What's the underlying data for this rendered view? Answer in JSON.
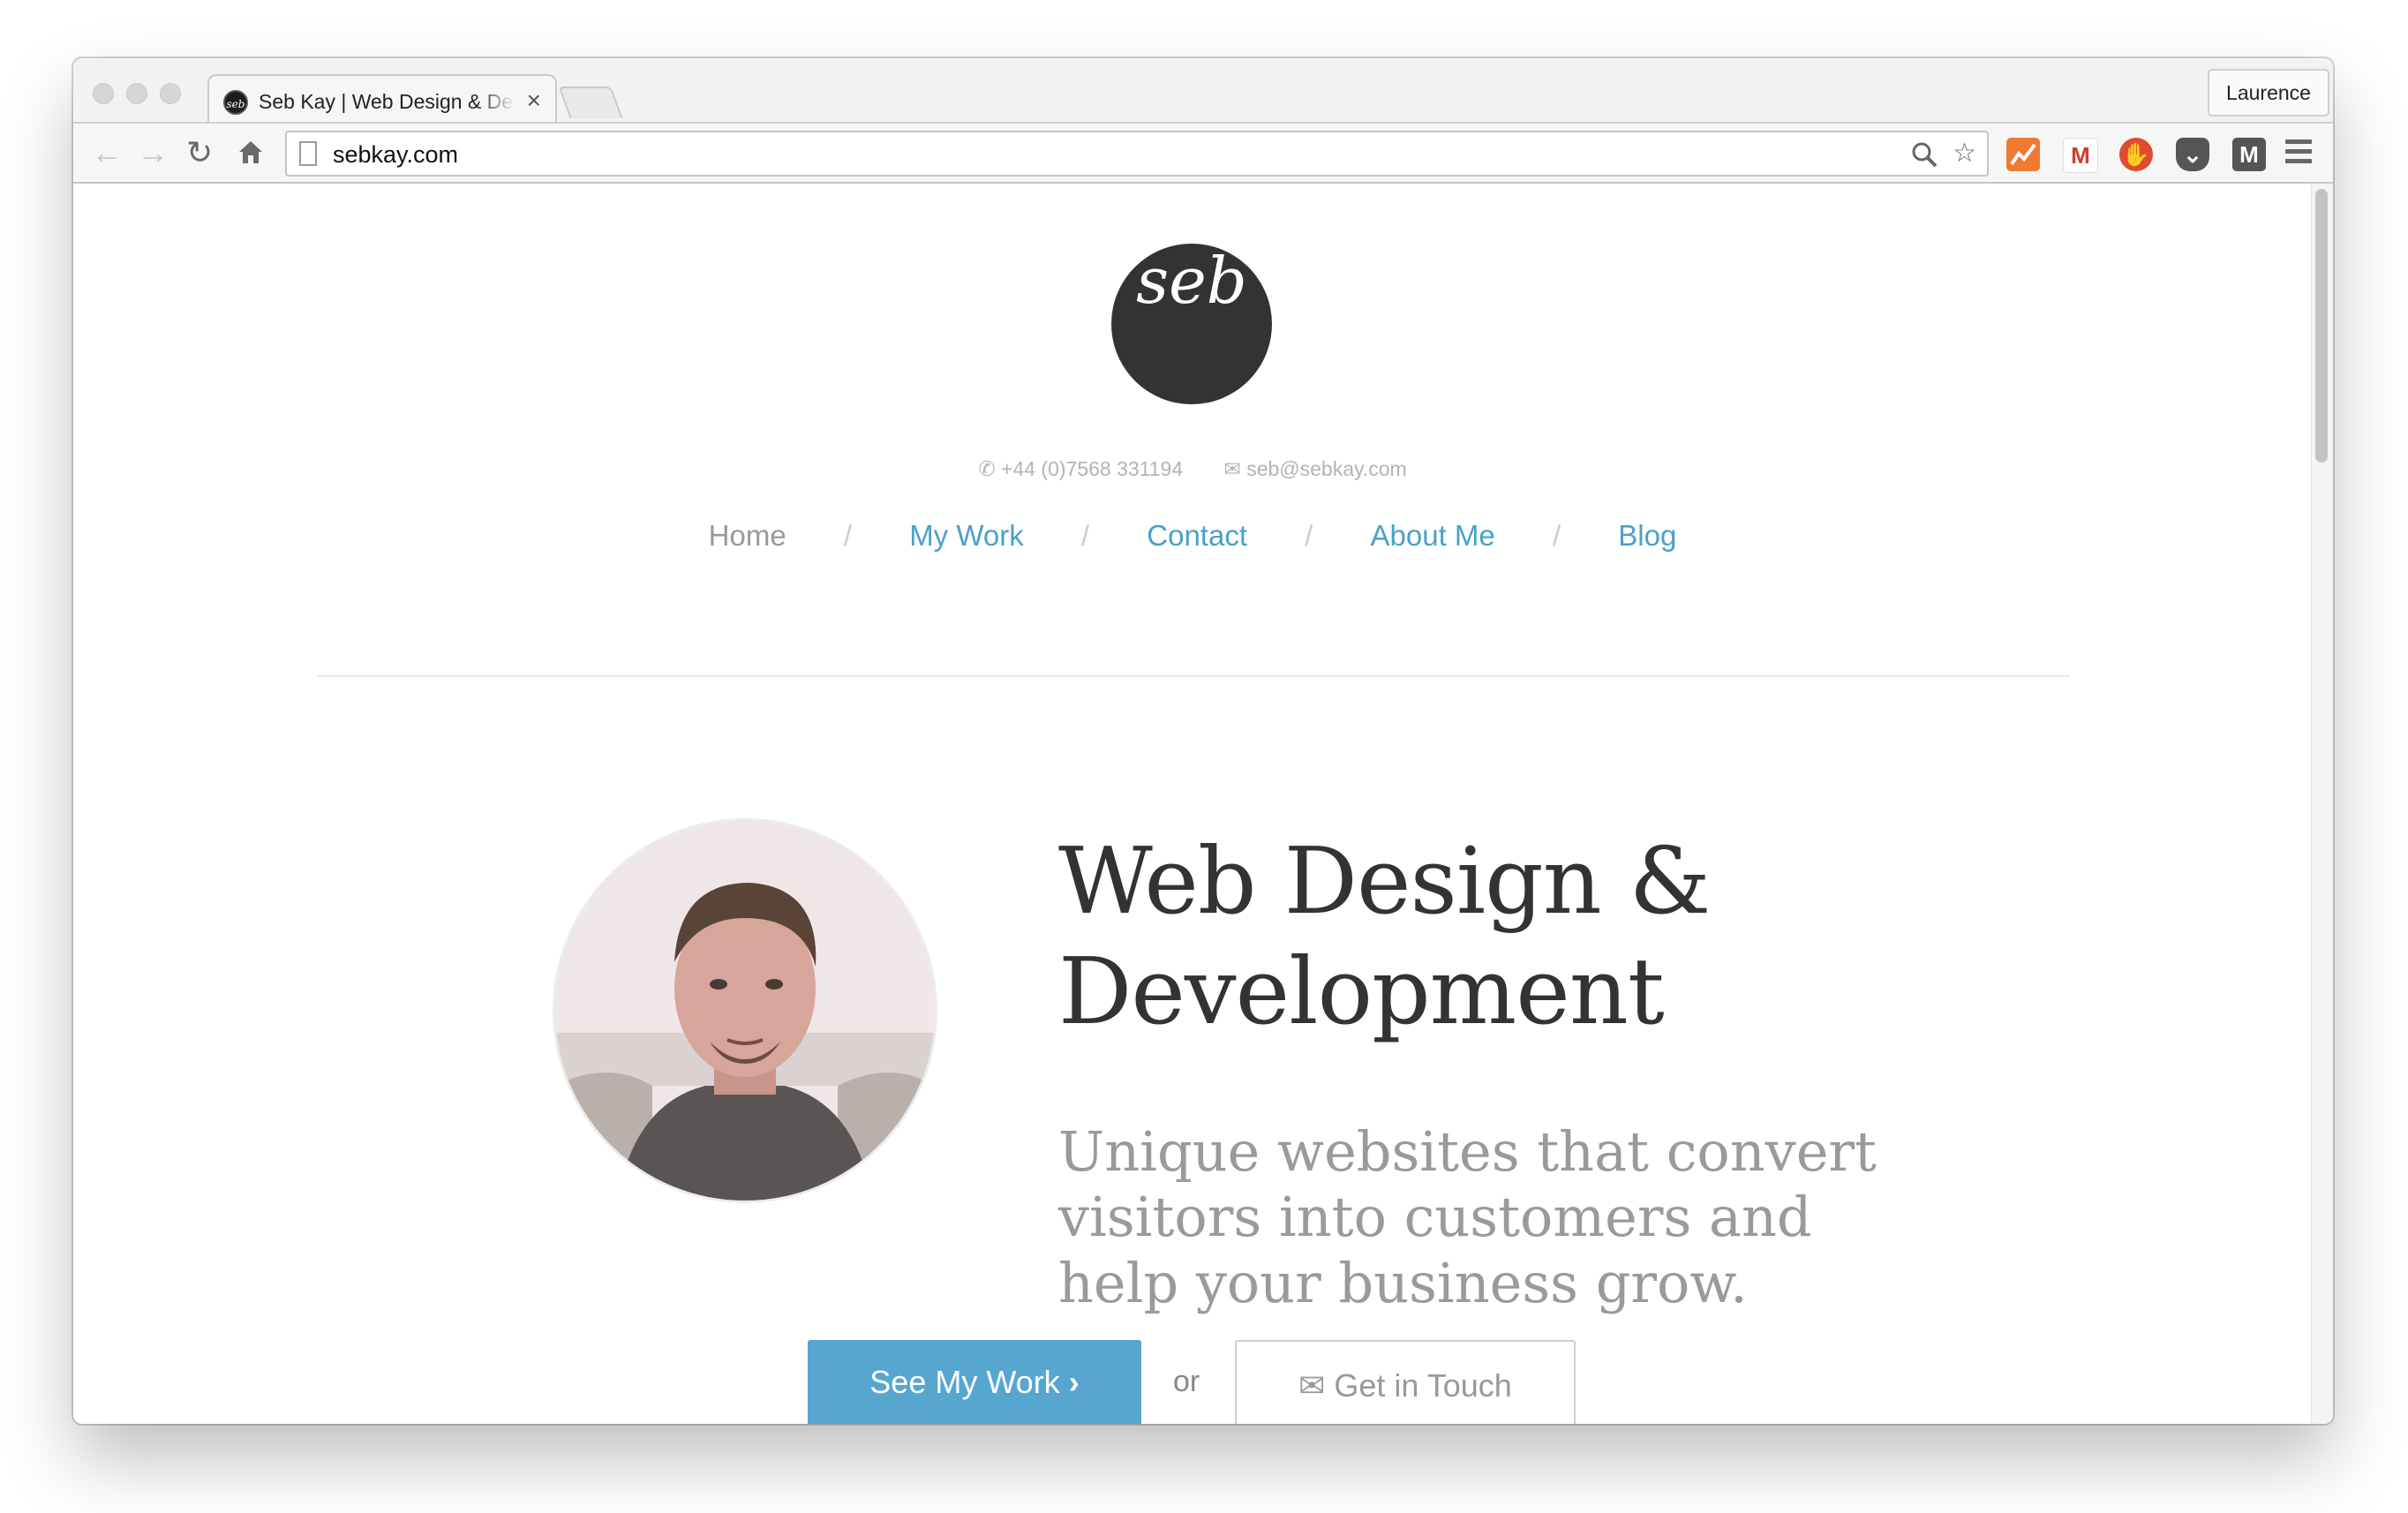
{
  "browser": {
    "tab_title": "Seb Kay | Web Design & Development",
    "tab_favicon_text": "seb",
    "tab_close": "×",
    "profile_name": "Laurence",
    "url": "sebkay.com"
  },
  "site": {
    "logo_text": "seb",
    "phone": "+44 (0)7568 331194",
    "email": "seb@sebkay.com",
    "nav": [
      {
        "label": "Home"
      },
      {
        "label": "My Work"
      },
      {
        "label": "Contact"
      },
      {
        "label": "About Me"
      },
      {
        "label": "Blog"
      }
    ],
    "nav_separator": "/",
    "hero_title_line1": "Web Design &",
    "hero_title_line2": "Development",
    "hero_sub_line1": "Unique websites that convert",
    "hero_sub_line2": "visitors into customers and",
    "hero_sub_line3": "help your business grow.",
    "primary_button": "See My Work",
    "or_text": "or",
    "secondary_button": "Get in Touch"
  },
  "colors": {
    "accent": "#57a6d0",
    "link": "#4aa0c9",
    "logo_bg": "#333333"
  }
}
